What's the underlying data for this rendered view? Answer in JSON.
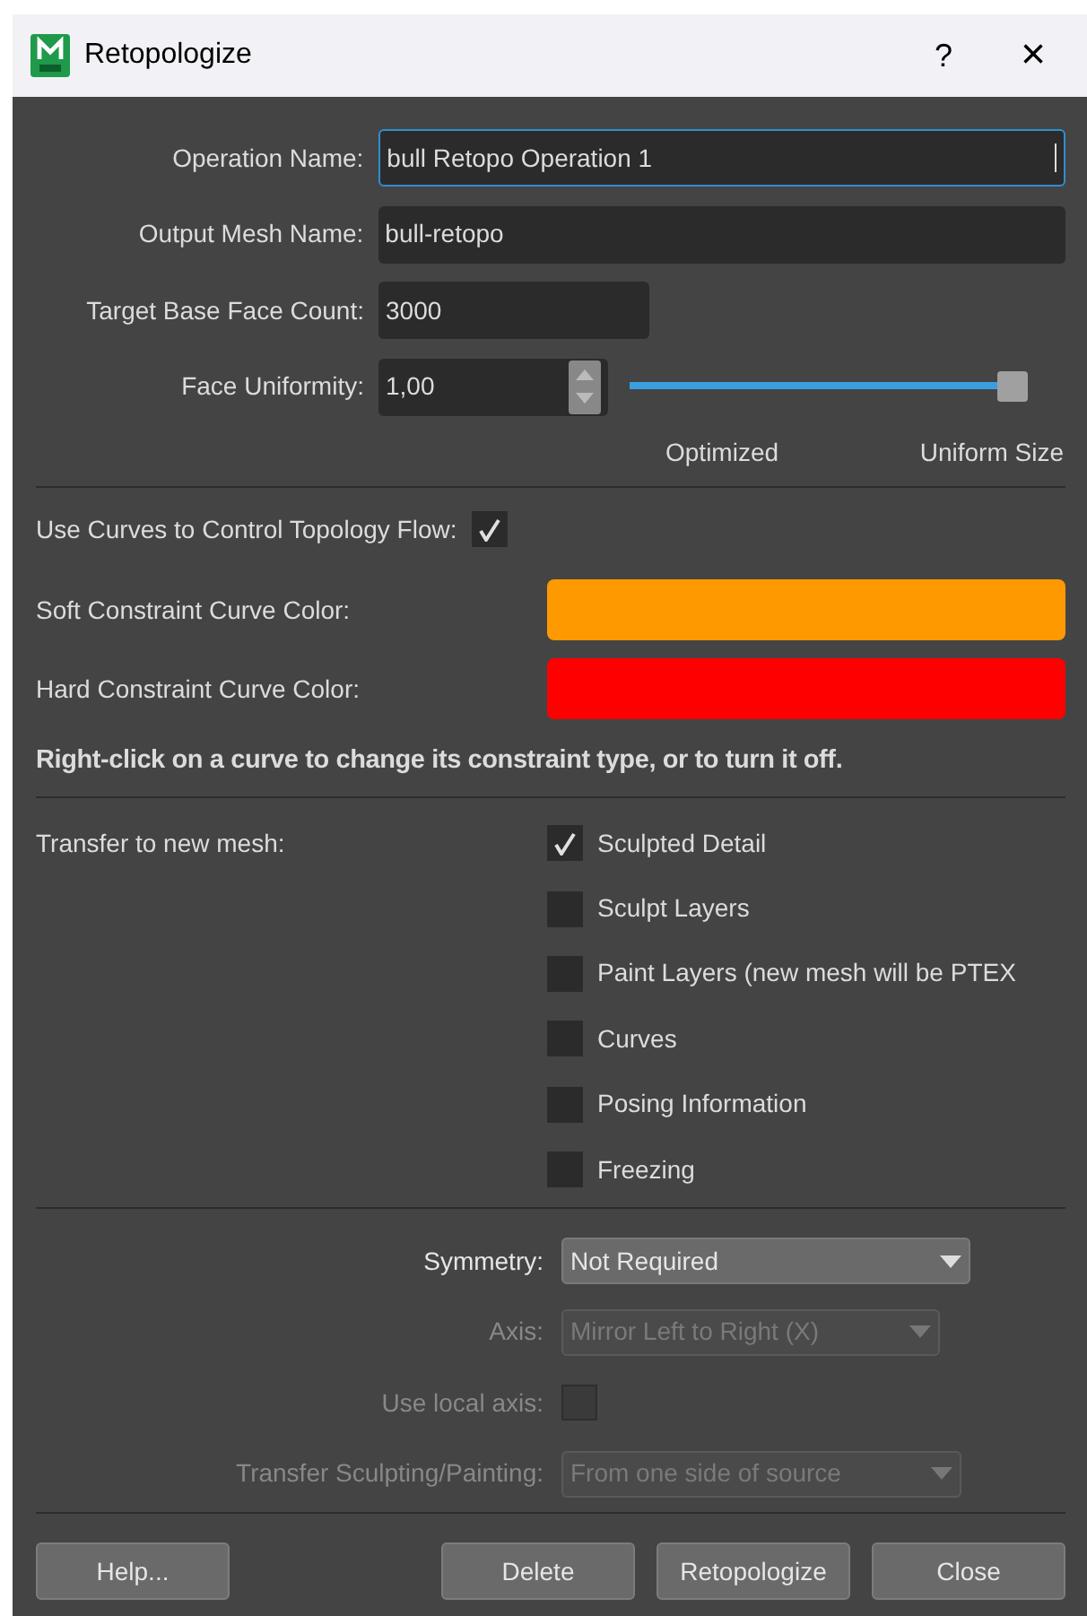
{
  "window": {
    "title": "Retopologize",
    "help": "?",
    "close": "×"
  },
  "fields": [
    {
      "label": "Operation Name:",
      "value": "bull Retopo Operation 1",
      "focused": true,
      "kind": "text"
    },
    {
      "label": "Output Mesh Name:",
      "value": "bull-retopo",
      "focused": false,
      "kind": "text"
    },
    {
      "label": "Target Base Face Count:",
      "value": "3000",
      "focused": false,
      "kind": "short"
    },
    {
      "label": "Face Uniformity:",
      "value": "1,00",
      "focused": false,
      "kind": "spin",
      "level": 1.0
    }
  ],
  "slider_labels": [
    "Optimized",
    "Uniform Size"
  ],
  "use_curves": {
    "label": "Use Curves to Control Topology Flow:",
    "checked": true
  },
  "curve_colors": [
    {
      "label": "Soft Constraint Curve Color:",
      "color": "#ff9900"
    },
    {
      "label": "Hard Constraint Curve Color:",
      "color": "#ff0000"
    }
  ],
  "hint": "Right-click on a curve to change its constraint type, or to turn it off.",
  "transfer": {
    "label": "Transfer to new mesh:",
    "options": [
      {
        "label": "Sculpted Detail",
        "checked": true
      },
      {
        "label": "Sculpt Layers",
        "checked": false
      },
      {
        "label": "Paint Layers (new mesh will be PTEX",
        "checked": false
      },
      {
        "label": "Curves",
        "checked": false
      },
      {
        "label": "Posing Information",
        "checked": false
      },
      {
        "label": "Freezing",
        "checked": false
      }
    ]
  },
  "symmetry": [
    {
      "label": "Symmetry:",
      "kind": "dropdown",
      "value": "Not Required",
      "disabled": false
    },
    {
      "label": "Axis:",
      "kind": "dropdown",
      "value": "Mirror Left to Right (X)",
      "disabled": true
    },
    {
      "label": "Use local axis:",
      "kind": "checkbox",
      "checked": false,
      "disabled": true
    },
    {
      "label": "Transfer Sculpting/Painting:",
      "kind": "dropdown",
      "value": "From one side of source",
      "disabled": true
    }
  ],
  "buttons": [
    "Help...",
    "Delete",
    "Retopologize",
    "Close"
  ]
}
